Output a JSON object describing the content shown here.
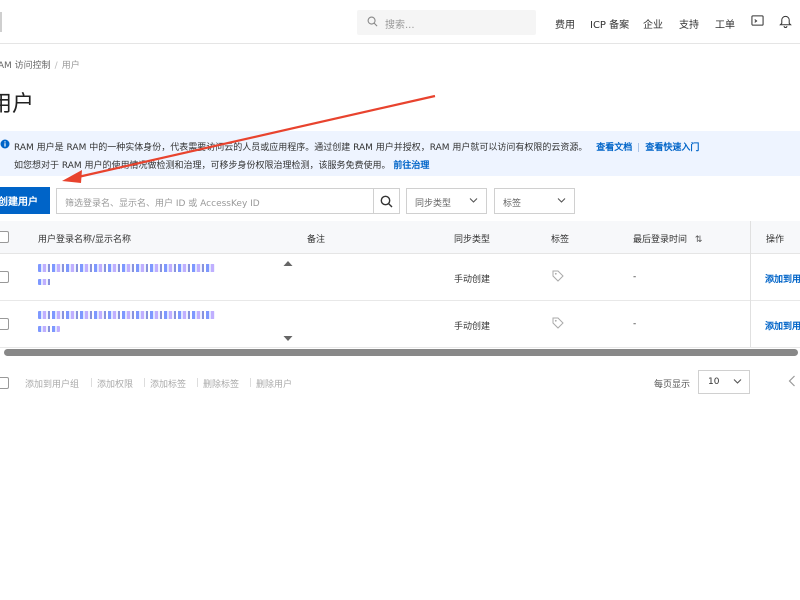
{
  "topbar": {
    "search_placeholder": "搜索...",
    "links": [
      "费用",
      "ICP 备案",
      "企业",
      "支持",
      "工单"
    ]
  },
  "breadcrumb": {
    "items": [
      "RAM 访问控制",
      "用户"
    ]
  },
  "page_title": "用户",
  "banner": {
    "line1": "RAM 用户是 RAM 中的一种实体身份，代表需要访问云的人员或应用程序。通过创建 RAM 用户并授权，RAM 用户就可以访问有权限的云资源。",
    "link_docs": "查看文档",
    "link_quickstart": "查看快速入门",
    "line2": "如您想对于 RAM 用户的使用情况做检测和治理，可移步身份权限治理检测，该服务免费使用。",
    "link_govern": "前往治理"
  },
  "toolbar": {
    "create_label": "创建用户",
    "filter_placeholder": "筛选登录名、显示名、用户 ID 或 AccessKey ID",
    "sync_type_label": "同步类型",
    "tag_label": "标签"
  },
  "table": {
    "columns": {
      "name": "用户登录名称/显示名称",
      "note": "备注",
      "sync": "同步类型",
      "tag": "标签",
      "last_login": "最后登录时间",
      "action": "操作"
    },
    "rows": [
      {
        "sync": "手动创建",
        "last_login": "-",
        "action": "添加到用"
      },
      {
        "sync": "手动创建",
        "last_login": "-",
        "action": "添加到用"
      }
    ]
  },
  "footer": {
    "actions": [
      "添加到用户组",
      "添加权限",
      "添加标签",
      "删除标签",
      "删除用户"
    ],
    "page_size_label": "每页显示",
    "page_size": "10"
  },
  "colors": {
    "primary": "#0064c8",
    "banner_bg": "#eef4ff",
    "annotation_arrow": "#e8432e"
  },
  "icons": [
    "search-icon",
    "terminal-icon",
    "bell-icon",
    "info-icon",
    "chevron-down-icon",
    "sort-icon",
    "tag-icon",
    "chevron-left-icon"
  ]
}
